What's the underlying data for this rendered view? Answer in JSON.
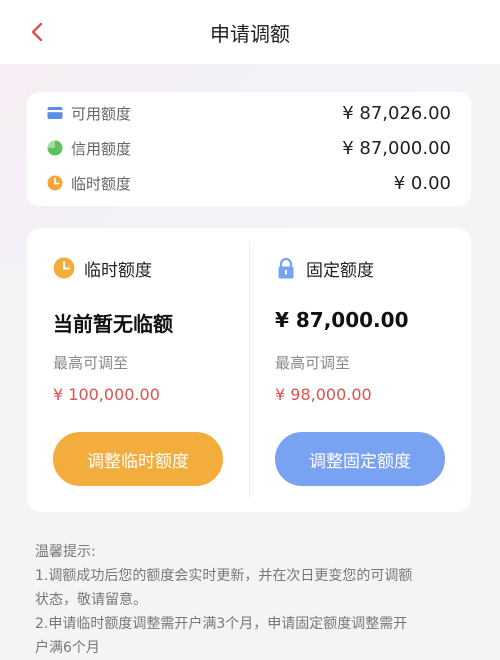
{
  "header": {
    "title": "申请调额",
    "back_icon": "chevron-left-icon"
  },
  "summary": {
    "rows": [
      {
        "label": "可用额度",
        "amount": "¥ 87,026.00",
        "icon": "card-icon",
        "color": "#5b8de8"
      },
      {
        "label": "信用额度",
        "amount": "¥ 87,000.00",
        "icon": "pie-icon",
        "color": "#5cc25c"
      },
      {
        "label": "临时额度",
        "amount": "¥ 0.00",
        "icon": "clock-icon",
        "color": "#f3a53c"
      }
    ]
  },
  "temp": {
    "title": "临时额度",
    "main": "当前暂无临额",
    "sub": "最高可调至",
    "limit": "¥ 100,000.00",
    "button": "调整临时额度",
    "icon": "clock-icon",
    "color": "#f3ad3c"
  },
  "fixed": {
    "title": "固定额度",
    "main": "¥ 87,000.00",
    "sub": "最高可调至",
    "limit": "¥ 98,000.00",
    "button": "调整固定额度",
    "icon": "lock-icon",
    "color": "#7aa2f2"
  },
  "tips": {
    "title": "温馨提示:",
    "line1a": "1.调额成功后您的额度会实时更新，并在次日更变您的可调额",
    "line1b": "状态，敬请留意。",
    "line2a": "2.申请临时额度调整需开户满3个月，申请固定额度调整需开",
    "line2b": "户满6个月"
  },
  "colors": {
    "accent_red": "#d9534f",
    "background": "#f4f4f6"
  }
}
